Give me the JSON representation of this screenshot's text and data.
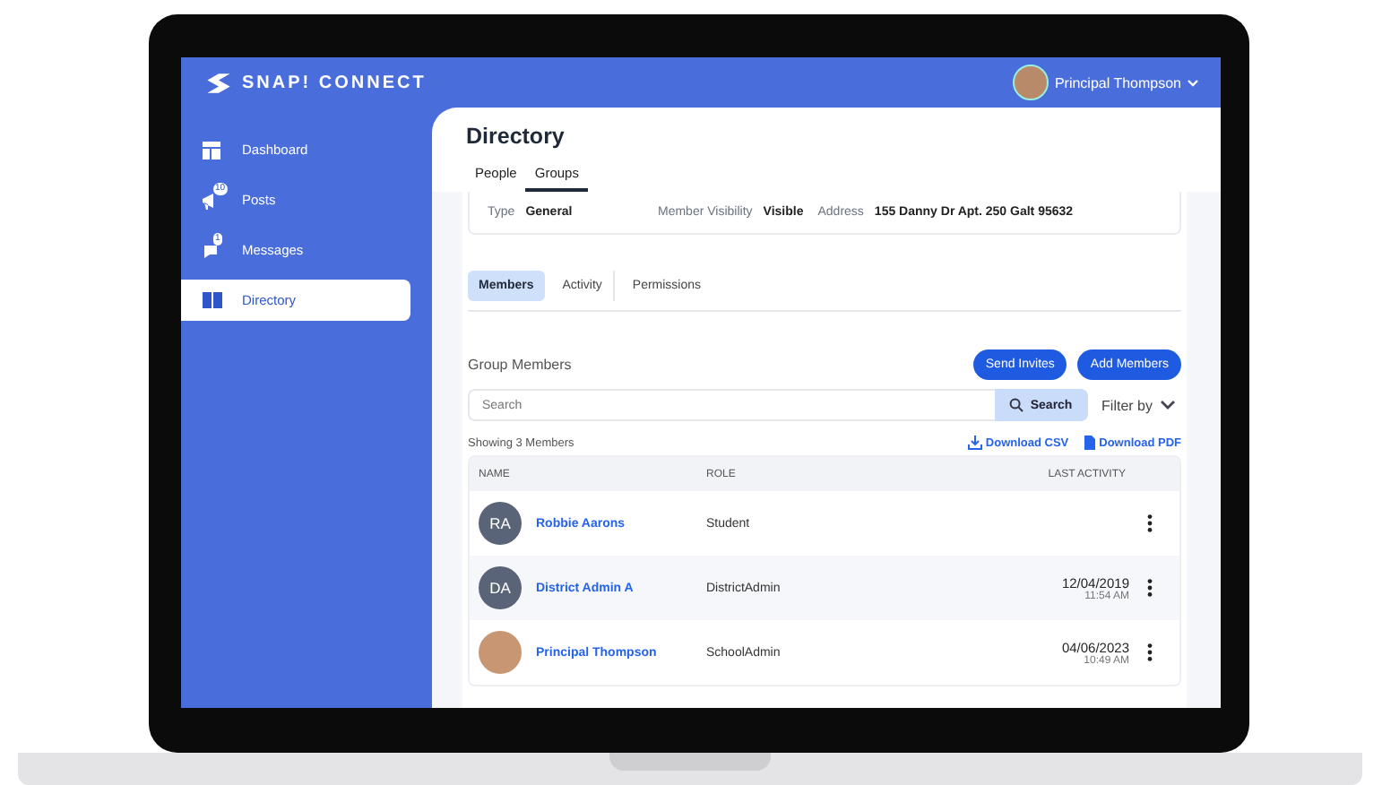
{
  "header": {
    "logo": "SNAP! CONNECT",
    "user": "Principal Thompson"
  },
  "sidebar": {
    "items": [
      {
        "label": "Dashboard",
        "selected": false
      },
      {
        "label": "Posts",
        "badge": "10",
        "selected": false
      },
      {
        "label": "Messages",
        "badge": "1",
        "selected": false
      },
      {
        "label": "Directory",
        "selected": true
      }
    ]
  },
  "page": {
    "title": "Directory",
    "tabs": [
      {
        "label": "People",
        "selected": false
      },
      {
        "label": "Groups",
        "selected": true
      }
    ]
  },
  "group_info": [
    {
      "label": "Type",
      "value": "General"
    },
    {
      "label": "Member Visibility",
      "value": "Visible"
    },
    {
      "label": "Address",
      "value": "155 Danny Dr Apt. 250 Galt 95632"
    }
  ],
  "section_tabs": [
    {
      "label": "Members",
      "selected": true
    },
    {
      "label": "Activity",
      "selected": false
    },
    {
      "label": "Permissions",
      "selected": false
    }
  ],
  "members": {
    "title": "Group Members",
    "buttons": [
      "Send Invites",
      "Add Members"
    ],
    "search": {
      "placeholder": "Search",
      "button": "Search"
    },
    "filter": "Filter by",
    "count": "Showing 3 Members",
    "downloads": [
      {
        "kind": "csv",
        "label": "Download CSV"
      },
      {
        "kind": "pdf",
        "label": "Download PDF"
      }
    ],
    "columns": [
      "NAME",
      "ROLE",
      "LAST ACTIVITY"
    ],
    "rows": [
      {
        "kind": "initials",
        "initials": "RA",
        "name": "Robbie Aarons",
        "role": "Student"
      },
      {
        "kind": "initials",
        "initials": "DA",
        "name": "District Admin A",
        "role": "DistrictAdmin",
        "date": "12/04/2019",
        "time": "11:54 AM"
      },
      {
        "kind": "photo",
        "name": "Principal Thompson",
        "role": "SchoolAdmin",
        "date": "04/06/2023",
        "time": "10:49 AM"
      }
    ]
  }
}
